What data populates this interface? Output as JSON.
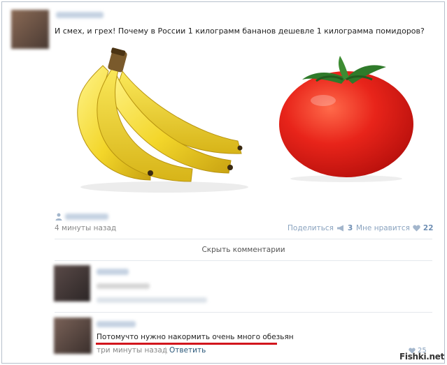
{
  "post": {
    "text": "И смех, и грех! Почему в России 1 килограмм бананов дешевле 1 килограмма помидоров?",
    "time": "4 минуты назад",
    "share_label": "Поделиться",
    "share_count": "3",
    "like_label": "Мне нравится",
    "like_count": "22"
  },
  "comments_toggle": "Скрыть комментарии",
  "comment": {
    "text": "Потомучто нужно накормить очень много обезьян",
    "time": "три минуты назад",
    "separator": "|",
    "reply_label": "Ответить",
    "like_count": "25"
  },
  "watermark": "Fishki.net",
  "colors": {
    "link": "#2b587a",
    "meta": "#888888",
    "like_blue": "#6f8fb4",
    "underline_red": "#d2161d"
  }
}
